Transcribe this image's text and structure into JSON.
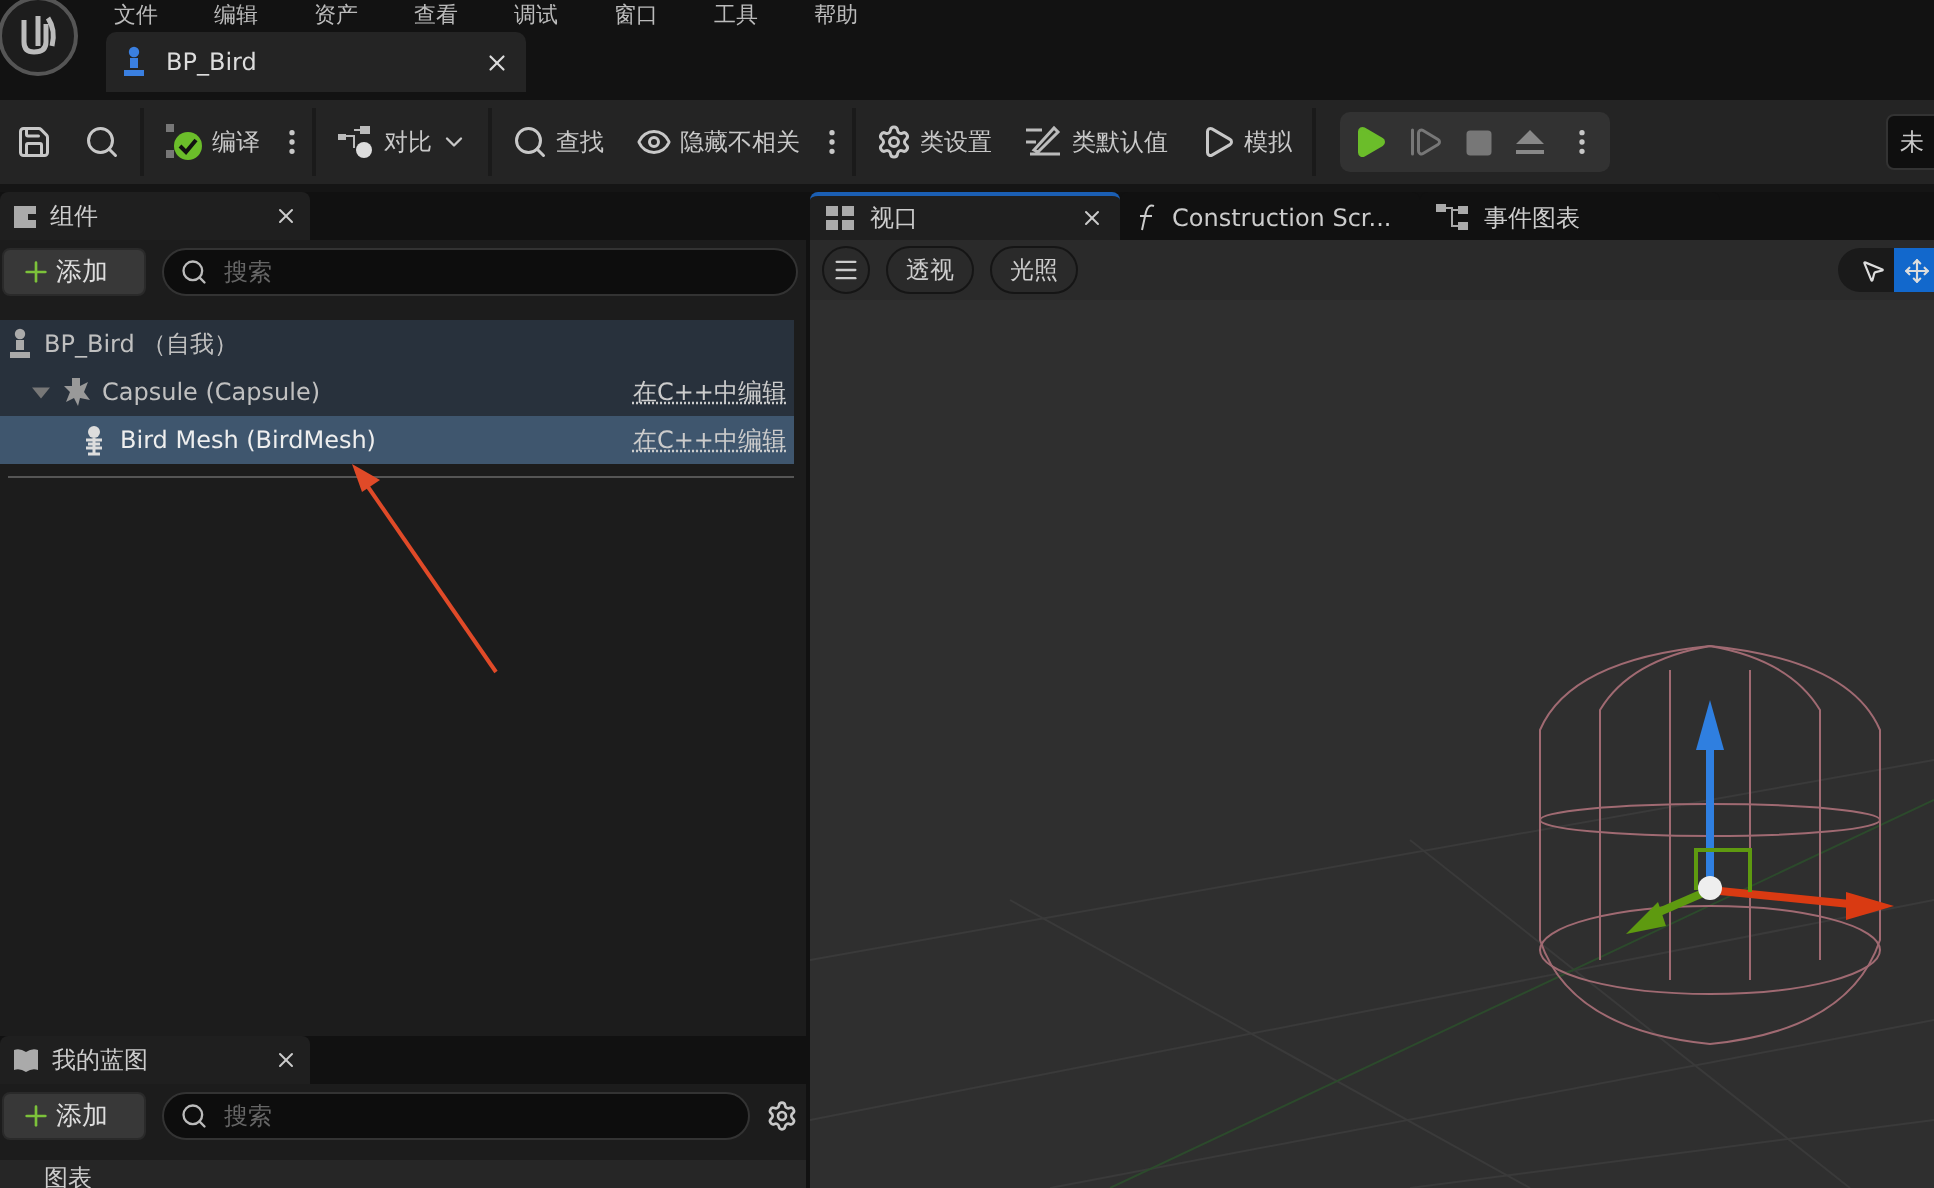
{
  "menu": [
    "文件",
    "编辑",
    "资产",
    "查看",
    "调试",
    "窗口",
    "工具",
    "帮助"
  ],
  "document_tab": {
    "title": "BP_Bird",
    "selected": true
  },
  "toolbar": {
    "compile": "编译",
    "diff": "对比",
    "find": "查找",
    "hide_unrelated": "隐藏不相关",
    "class_settings": "类设置",
    "class_defaults": "类默认值",
    "simulate": "模拟",
    "mode_field": "未"
  },
  "components": {
    "tab": "组件",
    "add": "添加",
    "search_placeholder": "搜索",
    "self_row": "BP_Bird （自我）",
    "tree": [
      {
        "label": "Capsule (Capsule)",
        "link": "在C++中编辑",
        "selected": false,
        "expanded": true,
        "children": [
          {
            "label": "Bird Mesh (BirdMesh)",
            "link": "在C++中编辑",
            "selected": true
          }
        ]
      }
    ]
  },
  "my_blueprint": {
    "tab": "我的蓝图",
    "add": "添加",
    "search_placeholder": "搜索",
    "first_row": "图表"
  },
  "viewport": {
    "tabs": [
      {
        "label": "视口",
        "selected": true
      },
      {
        "label": "Construction Scr...",
        "selected": false
      },
      {
        "label": "事件图表",
        "selected": false
      }
    ],
    "view_buttons": [
      "透视",
      "光照"
    ],
    "tools": [
      {
        "kind": "select",
        "selected": false
      },
      {
        "kind": "move",
        "selected": true
      }
    ]
  }
}
